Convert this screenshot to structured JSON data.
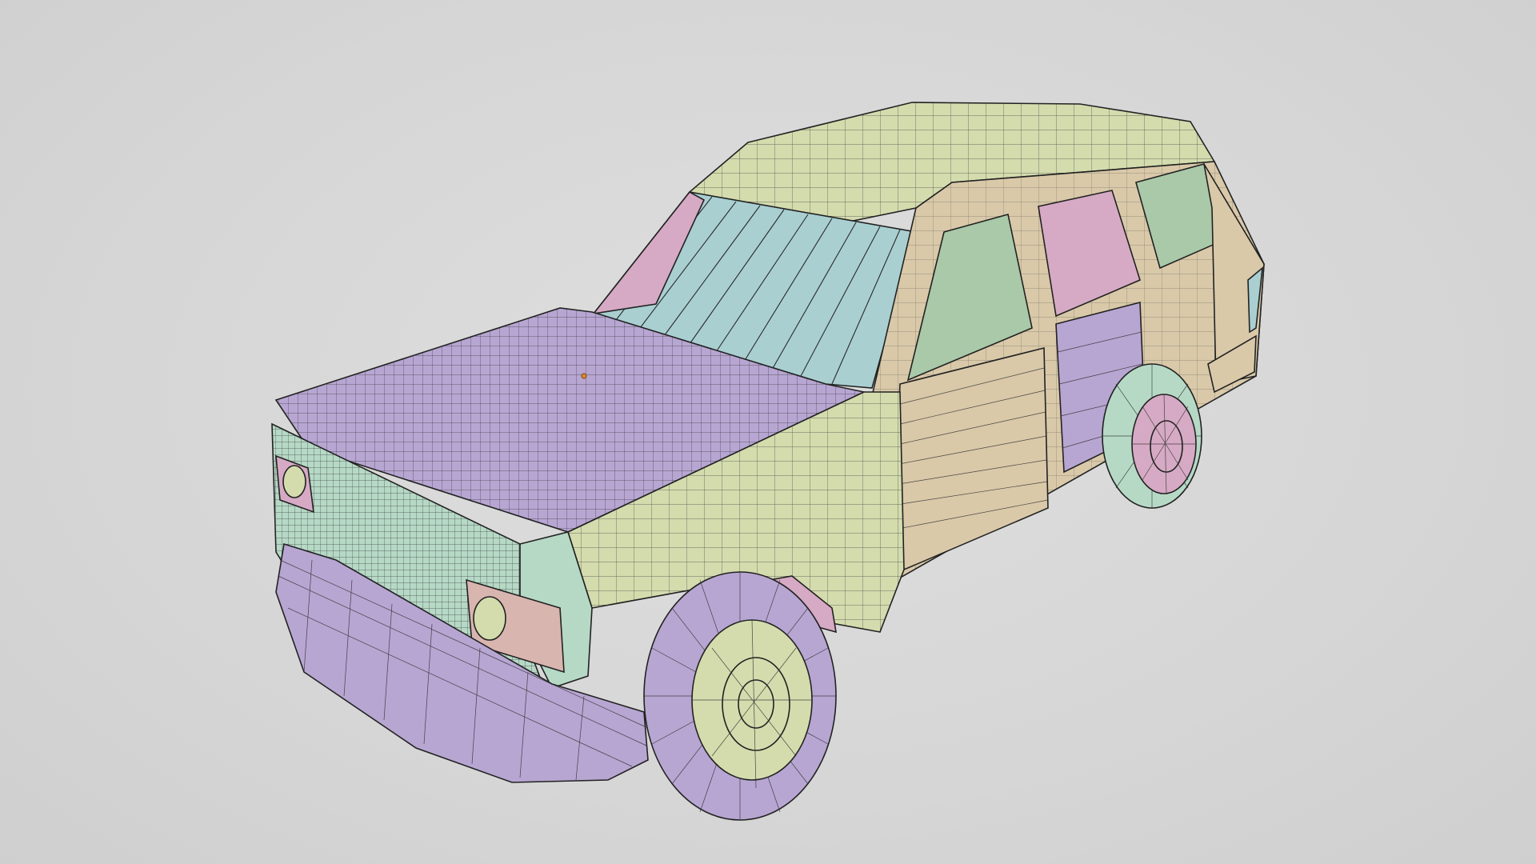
{
  "viewport": {
    "background": "#d8d8d8",
    "subject": "car-3d-wireframe",
    "face_set_colors": {
      "olive": "#d4dcae",
      "lavender": "#b7a6d2",
      "mint": "#b6d9c6",
      "sky": "#a9cfd1",
      "tan": "#d9c9a9",
      "pink": "#d6aac4",
      "green": "#a9c9a8"
    }
  }
}
